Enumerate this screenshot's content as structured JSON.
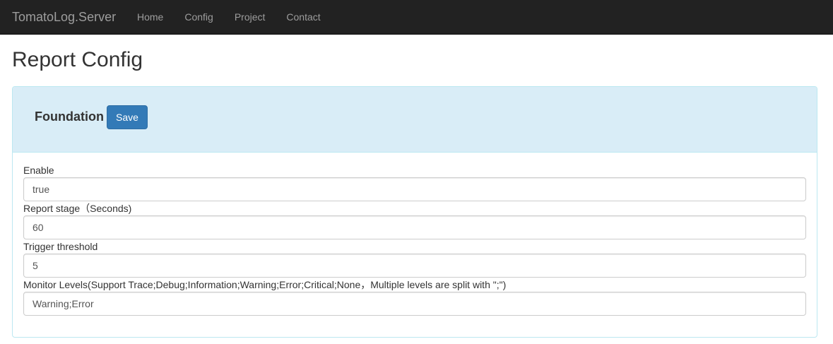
{
  "navbar": {
    "brand": "TomatoLog.Server",
    "items": [
      {
        "label": "Home"
      },
      {
        "label": "Config"
      },
      {
        "label": "Project"
      },
      {
        "label": "Contact"
      }
    ]
  },
  "page": {
    "title": "Report Config"
  },
  "panel": {
    "title": "Foundation",
    "save_label": "Save",
    "fields": [
      {
        "label": "Enable",
        "value": "true"
      },
      {
        "label": "Report stage（Seconds)",
        "value": "60"
      },
      {
        "label": "Trigger threshold",
        "value": "5"
      },
      {
        "label": "Monitor Levels(Support Trace;Debug;Information;Warning;Error;Critical;None，Multiple levels are split with \";\")",
        "value": "Warning;Error"
      }
    ]
  },
  "colors": {
    "navbar_bg": "#222222",
    "panel_heading_bg": "#d9edf7",
    "panel_border": "#bce8f1",
    "primary_button": "#337ab7"
  }
}
